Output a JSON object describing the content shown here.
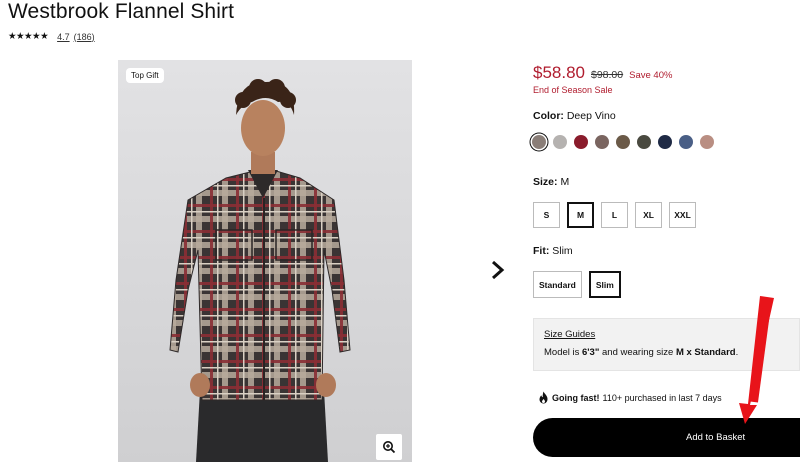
{
  "product": {
    "title": "Westbrook Flannel Shirt",
    "stars": "★★★★★",
    "rating": "4.7",
    "review_count": "(186)"
  },
  "image": {
    "badge": "Top Gift",
    "zoom_icon": "zoom-in-icon"
  },
  "price": {
    "current": "$58.80",
    "original": "$98.00",
    "save": "Save 40%",
    "sale_label": "End of Season Sale",
    "sale_color": "#b01c2e"
  },
  "color": {
    "label": "Color:",
    "value": "Deep Vino",
    "swatches": [
      "#8a7e78",
      "#b5b2b0",
      "#8a1c2c",
      "#7a6560",
      "#6b5a48",
      "#4a4a40",
      "#1f2a45",
      "#4a5f86",
      "#b98e82"
    ]
  },
  "size": {
    "label": "Size:",
    "value": "M",
    "options": [
      "S",
      "M",
      "L",
      "XL",
      "XXL"
    ]
  },
  "fit": {
    "label": "Fit:",
    "value": "Slim",
    "options": [
      "Standard",
      "Slim"
    ]
  },
  "guide": {
    "link": "Size Guides",
    "model_prefix": "Model is",
    "model_height": "6'3\"",
    "model_mid": "and wearing size",
    "model_size": "M x Standard",
    "model_end": "."
  },
  "urgency": {
    "bold": "Going fast!",
    "text": "110+ purchased in last 7 days"
  },
  "cta": {
    "label": "Add to Basket"
  }
}
